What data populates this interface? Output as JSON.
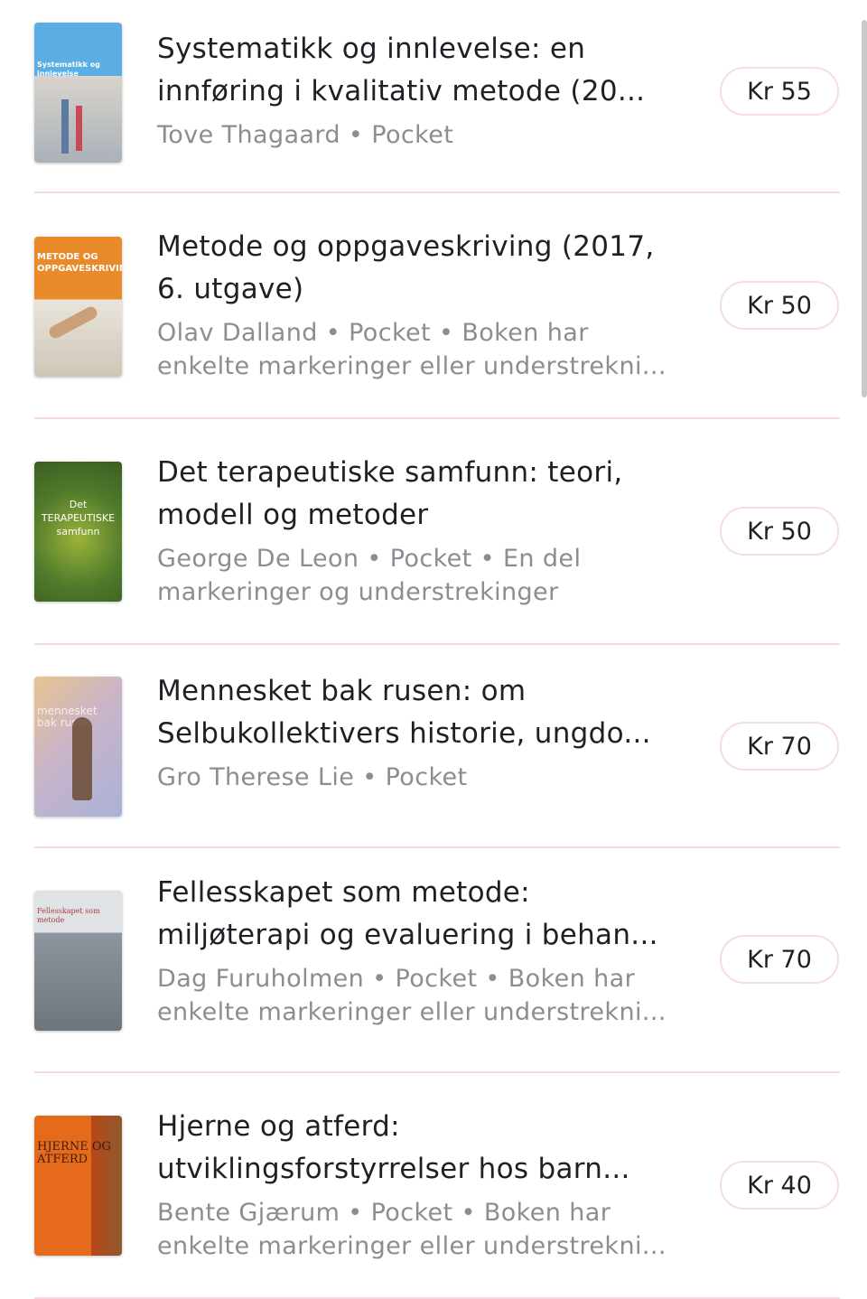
{
  "items": [
    {
      "title_line1": "Systematikk og innlevelse: en",
      "title_line2": "innføring i kvalitativ metode (20...",
      "meta_line1": "Tove Thagaard • Pocket",
      "meta_line2": "",
      "price": "Kr 55",
      "cover_text": "Systematikk og innlevelse",
      "cover_color": "#5aaee3"
    },
    {
      "title_line1": "Metode og oppgaveskriving (2017,",
      "title_line2": "6. utgave)",
      "meta_line1": "Olav Dalland • Pocket • Boken har",
      "meta_line2": "enkelte markeringer eller understrekni...",
      "price": "Kr 50",
      "cover_text": "METODE OG OPPGAVESKRIVING",
      "cover_color": "#e98b2a"
    },
    {
      "title_line1": "Det terapeutiske samfunn: teori,",
      "title_line2": "modell og metoder",
      "meta_line1": "George De Leon • Pocket • En del",
      "meta_line2": "markeringer og understrekinger",
      "price": "Kr 50",
      "cover_text": "Det TERAPEUTISKE samfunn",
      "cover_color": "#4f7a2b"
    },
    {
      "title_line1": "Mennesket bak rusen: om",
      "title_line2": "Selbukollektivers historie, ungdo...",
      "meta_line1": "Gro Therese Lie • Pocket",
      "meta_line2": "",
      "price": "Kr 70",
      "cover_text": "mennesket bak rusen",
      "cover_color": "#b7a6c2"
    },
    {
      "title_line1": "Fellesskapet som metode:",
      "title_line2": "miljøterapi og evaluering i behan...",
      "meta_line1": "Dag Furuholmen • Pocket • Boken har",
      "meta_line2": "enkelte markeringer eller understrekni...",
      "price": "Kr 70",
      "cover_text": "Fellesskapet som metode",
      "cover_color": "#9aa3ab"
    },
    {
      "title_line1": "Hjerne og atferd:",
      "title_line2": "utviklingsforstyrrelser hos barn...",
      "meta_line1": "Bente Gjærum • Pocket • Boken har",
      "meta_line2": "enkelte markeringer eller understrekni...",
      "price": "Kr 40",
      "cover_text": "HJERNE OG ATFERD",
      "cover_color": "#e56a1c"
    }
  ]
}
